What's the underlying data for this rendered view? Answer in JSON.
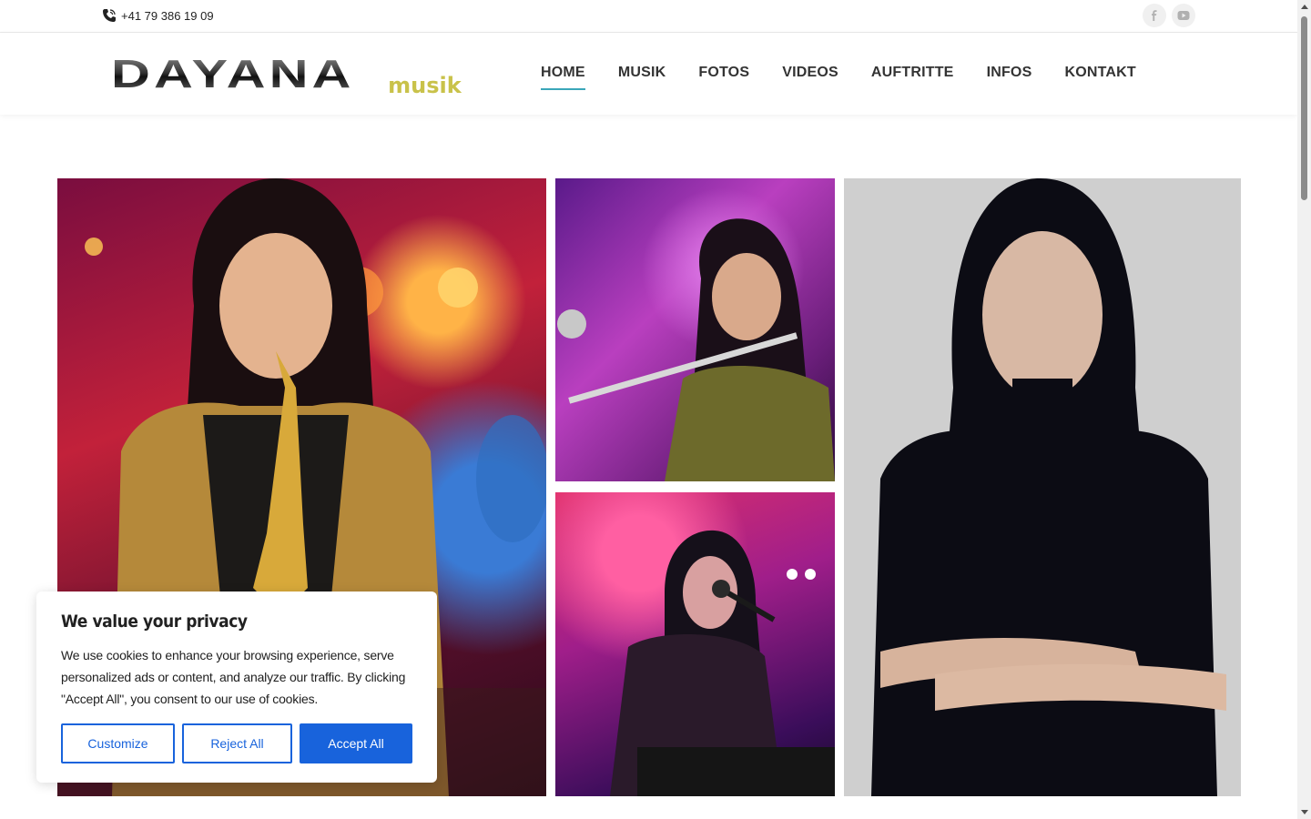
{
  "topbar": {
    "phone": "+41 79 386 19 09",
    "social": [
      {
        "icon": "facebook-icon",
        "label": "f"
      },
      {
        "icon": "youtube-icon",
        "label": "▶"
      }
    ]
  },
  "header": {
    "logo_main": "DAYANA",
    "logo_sub": "musik",
    "nav": [
      "HOME",
      "MUSIK",
      "FOTOS",
      "VIDEOS",
      "AUFTRITTE",
      "INFOS",
      "KONTAKT"
    ],
    "active_nav": "HOME",
    "accent_color": "#3aa6b9",
    "logo_sub_color": "#c9c24a"
  },
  "gallery": {
    "photos": [
      {
        "name": "photo-saxophone"
      },
      {
        "name": "photo-flute"
      },
      {
        "name": "photo-singing"
      },
      {
        "name": "photo-portrait"
      }
    ]
  },
  "cookie": {
    "title": "We value your privacy",
    "text": "We use cookies to enhance your browsing experience, serve personalized ads or content, and analyze our traffic. By clicking \"Accept All\", you consent to our use of cookies.",
    "customize": "Customize",
    "reject": "Reject All",
    "accept": "Accept All",
    "button_color": "#1863dc"
  }
}
